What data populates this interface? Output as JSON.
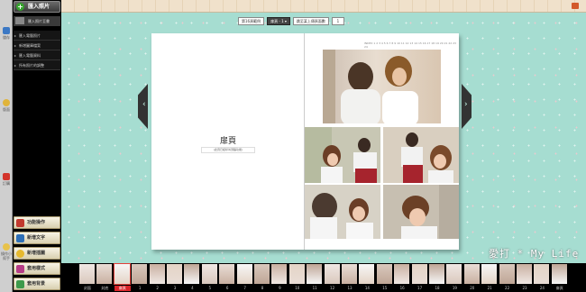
{
  "sidebar": {
    "add_photo_label": "匯入照片",
    "subhead_label": "匯入照片至書",
    "options": [
      "匯入電腦照片",
      "新增圖庫檔案",
      "匯入電腦資料",
      "所有照片的調整"
    ],
    "icon_labels": {
      "save": "儲存",
      "theme": "版面",
      "shop": "訂購",
      "help": "操作小幫手"
    },
    "tools": [
      "功能操作",
      "新增文字",
      "新增插圖",
      "套用樣式",
      "套用背景"
    ]
  },
  "toolbar": {
    "page_select": "第16頁範例",
    "view_select": "扉頁 - 1",
    "jump_label": "跳至某上傳頁面數",
    "page_input": "1"
  },
  "book": {
    "title": "扉頁",
    "subtitle": "(此頁已經呼叫頭腦功能)",
    "right_header": "INDEX 1 2 3 4 5 6 7 8 9 10 11 12 13 14 15 16 17 18 19 20 21 22 23 24"
  },
  "filmstrip": {
    "labels": [
      "封面",
      "封底",
      "扉頁",
      "1",
      "2",
      "3",
      "4",
      "5",
      "6",
      "7",
      "8",
      "9",
      "10",
      "11",
      "12",
      "13",
      "14",
      "15",
      "16",
      "17",
      "18",
      "19",
      "20",
      "21",
      "22",
      "23",
      "24",
      "扉頁"
    ],
    "selected_index": 2
  },
  "watermark": "愛打 * My Life\nphoto by wa..a",
  "colors": {
    "canvas": "#a6ddd1",
    "accent": "#d8242a",
    "tool": "#efe6c8"
  }
}
